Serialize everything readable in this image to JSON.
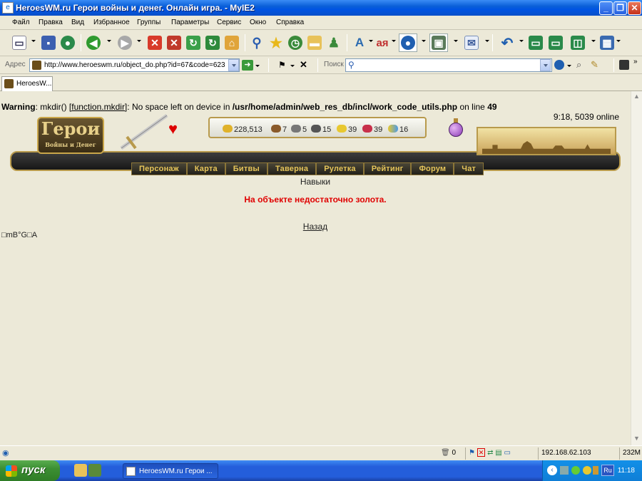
{
  "window": {
    "title": "HeroesWM.ru Герои войны и денег. Онлайн игра. - MyIE2"
  },
  "menu": [
    "Файл",
    "Правка",
    "Вид",
    "Избранное",
    "Группы",
    "Параметры",
    "Сервис",
    "Окно",
    "Справка"
  ],
  "address": {
    "label": "Адрес",
    "url": "http://www.heroeswm.ru/object_do.php?id=67&code=623",
    "search_label": "Поиск",
    "search_value": ""
  },
  "tabs": [
    {
      "label": "HeroesW..."
    }
  ],
  "page": {
    "warning_prefix": "Warning",
    "warning_func": "mkdir()",
    "warning_link": "[function.mkdir]",
    "warning_text": ": No space left on device in",
    "warning_path": "/usr/home/admin/web_res_db/incl/work_code_utils.php",
    "warning_online_text": "on line",
    "warning_line": "49",
    "online": "9:18, 5039 online",
    "logo_title": "Герои",
    "logo_subtitle": "Войны и Денег",
    "stats": {
      "gold": "228,513",
      "wood": "7",
      "ore": "5",
      "mercury": "15",
      "sulfur": "39",
      "crystals": "39",
      "gems": "16"
    },
    "nav": [
      "Персонаж",
      "Карта",
      "Битвы",
      "Таверна",
      "Рулетка",
      "Рейтинг",
      "Форум",
      "Чат"
    ],
    "section_label": "Навыки",
    "message": "На объекте недостаточно золота.",
    "back_link": "Назад",
    "garbage_text": "□mB°G□A"
  },
  "statusbar": {
    "counter": "0",
    "ip": "192.168.62.103",
    "memory": "232M"
  },
  "taskbar": {
    "start_label": "пуск",
    "task_item": "HeroesWM.ru Герои ...",
    "lang": "Ru",
    "clock": "11:18"
  },
  "colors": {
    "titlebar": "#0054e3",
    "message": "#e00000",
    "nav_text": "#e6c55a",
    "window_bg": "#ece9d8"
  }
}
